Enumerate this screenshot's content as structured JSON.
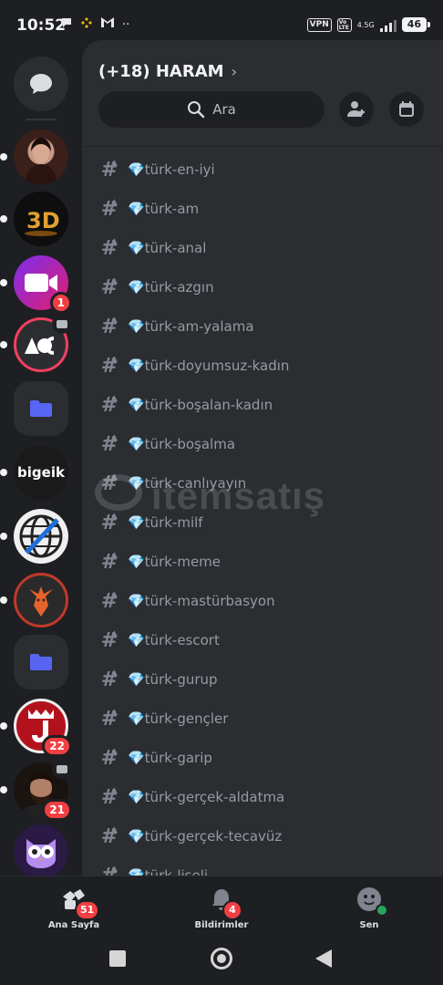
{
  "status_bar": {
    "time": "10:52",
    "vpn": "VPN",
    "volte": "Vo LTE",
    "network": "4.5G",
    "battery": "46"
  },
  "server": {
    "name": "(+18) HARAM",
    "search_label": "Ara"
  },
  "channels": [
    "💎türk-en-iyi",
    "💎türk-am",
    "💎türk-anal",
    "💎türk-azgın",
    "💎türk-am-yalama",
    "💎türk-doyumsuz-kadın",
    "💎türk-boşalan-kadın",
    "💎türk-boşalma",
    "💎türk-canlıyayın",
    "💎türk-milf",
    "💎türk-meme",
    "💎türk-mastürbasyon",
    "💎türk-escort",
    "💎türk-gurup",
    "💎türk-gençler",
    "💎türk-garip",
    "💎türk-gerçek-aldatma",
    "💎türk-gerçek-tecavüz",
    "💎türk-liseli"
  ],
  "rail_badges": {
    "video_server": "1",
    "server_j": "22",
    "server_beard": "21"
  },
  "rail_text": {
    "bigeik": "bigeik"
  },
  "watermark": "itemsatış",
  "bottom_nav": {
    "home_label": "Ana Sayfa",
    "home_badge": "51",
    "notifications_label": "Bildirimler",
    "notifications_badge": "4",
    "you_label": "Sen"
  },
  "colors": {
    "background": "#1e1f22",
    "panel": "#2b2d31",
    "badge": "#f23f43",
    "online": "#23a55a",
    "folder": "#5865f2"
  }
}
